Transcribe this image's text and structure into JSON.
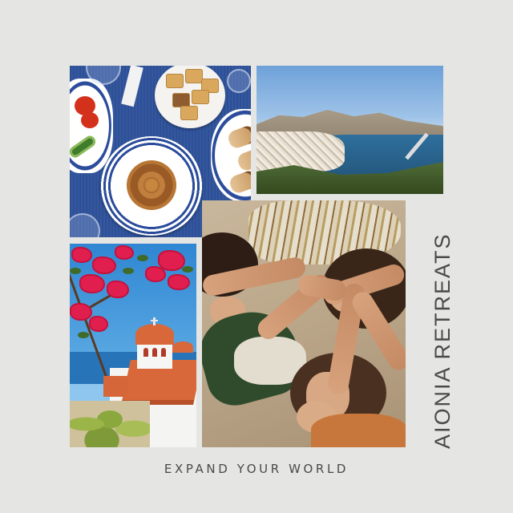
{
  "brand": {
    "title": "AIONIA RETREATS"
  },
  "tagline": "EXPAND YOUR WORLD",
  "colors": {
    "background": "#e5e5e3",
    "text": "#4a4a48"
  },
  "photos": [
    {
      "name": "food-photo",
      "subject": "greek-meze-spread"
    },
    {
      "name": "harbor-photo",
      "subject": "island-harbor-view"
    },
    {
      "name": "church-photo",
      "subject": "whitewashed-church-bougainvillea"
    },
    {
      "name": "women-photo",
      "subject": "women-joining-hands"
    }
  ]
}
